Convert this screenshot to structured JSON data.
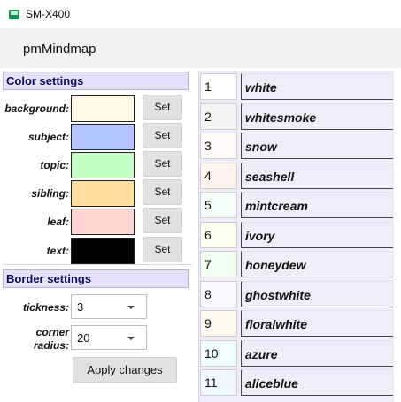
{
  "window": {
    "title": "SM-X400"
  },
  "app": {
    "name": "pmMindmap"
  },
  "color_settings": {
    "heading": "Color settings",
    "set_label": "Set",
    "rows": [
      {
        "label": "background:",
        "color": "#fffbe8"
      },
      {
        "label": "subject:",
        "color": "#b3c6ff"
      },
      {
        "label": "topic:",
        "color": "#c6ffc6"
      },
      {
        "label": "sibling:",
        "color": "#ffde9e"
      },
      {
        "label": "leaf:",
        "color": "#ffd6d2"
      },
      {
        "label": "text:",
        "color": "#000000"
      }
    ]
  },
  "border_settings": {
    "heading": "Border settings",
    "thickness_label": "tickness:",
    "thickness_value": "3",
    "corner_label_line1": "corner",
    "corner_label_line2": "radius:",
    "corner_value": "20",
    "apply_label": "Apply changes"
  },
  "color_list": [
    {
      "num": "1",
      "name": "white",
      "color": "#ffffff"
    },
    {
      "num": "2",
      "name": "whitesmoke",
      "color": "#f5f5f5"
    },
    {
      "num": "3",
      "name": "snow",
      "color": "#fffafa"
    },
    {
      "num": "4",
      "name": "seashell",
      "color": "#fff5ee"
    },
    {
      "num": "5",
      "name": "mintcream",
      "color": "#f5fffa"
    },
    {
      "num": "6",
      "name": "ivory",
      "color": "#fffff0"
    },
    {
      "num": "7",
      "name": "honeydew",
      "color": "#f0fff0"
    },
    {
      "num": "8",
      "name": "ghostwhite",
      "color": "#f8f8ff"
    },
    {
      "num": "9",
      "name": "floralwhite",
      "color": "#fffaf0"
    },
    {
      "num": "10",
      "name": "azure",
      "color": "#f0ffff"
    },
    {
      "num": "11",
      "name": "aliceblue",
      "color": "#f0f8ff"
    }
  ]
}
